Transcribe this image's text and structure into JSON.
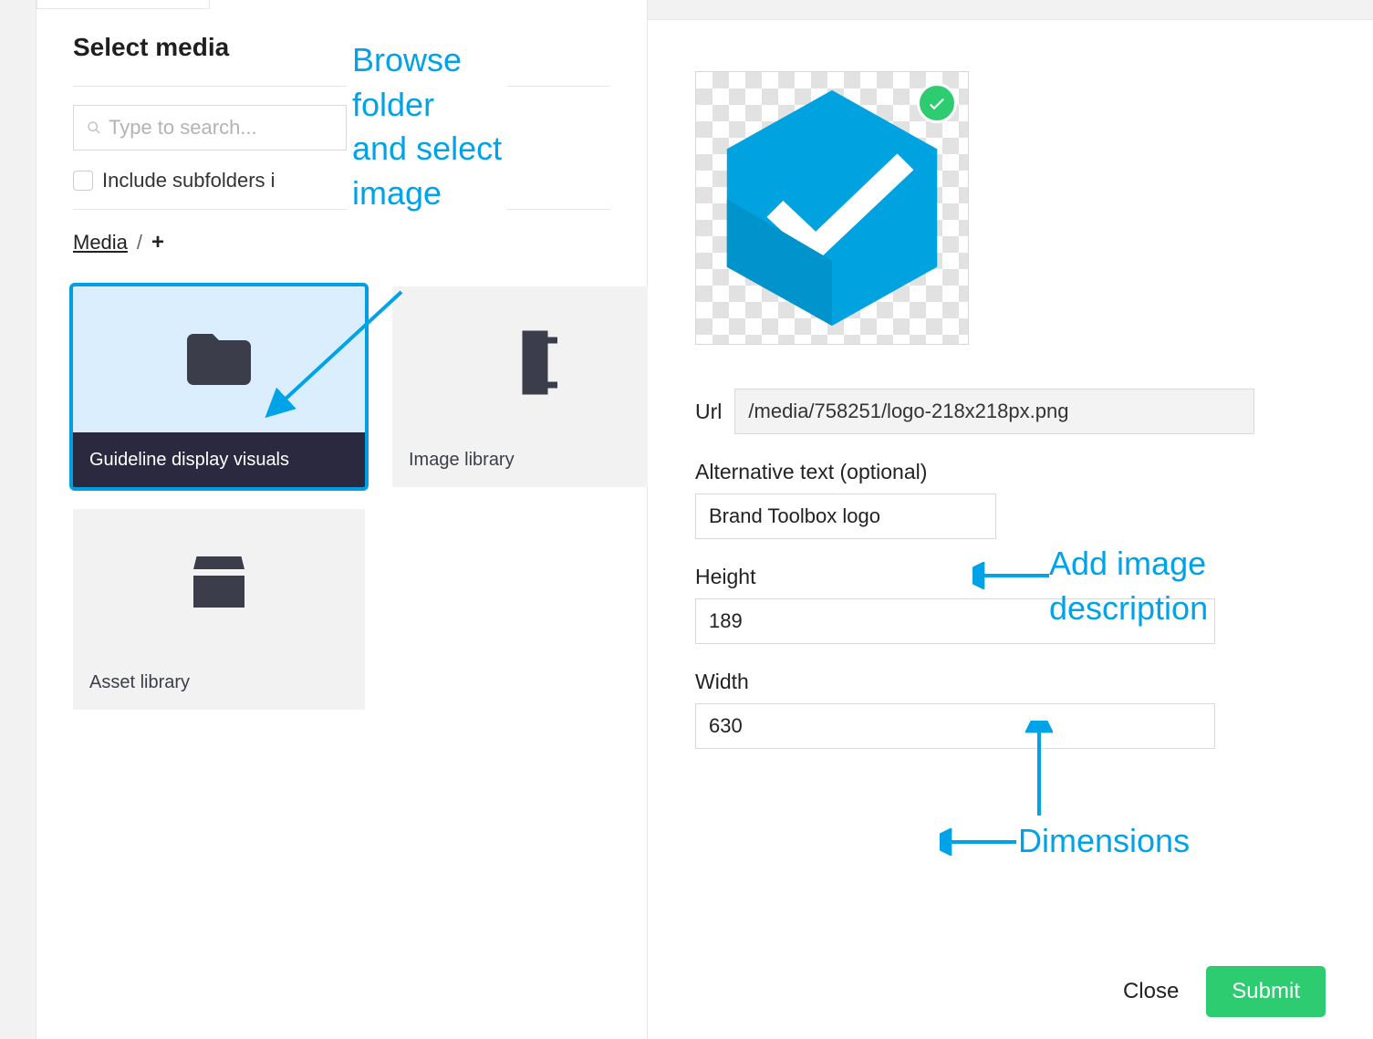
{
  "left": {
    "title": "Select media",
    "search_placeholder": "Type to search...",
    "include_subfolders_label": "Include subfolders i",
    "breadcrumb": {
      "root": "Media",
      "sep": "/",
      "add": "+"
    },
    "tiles": [
      {
        "label": "Guideline display visuals",
        "icon": "folder",
        "selected": true
      },
      {
        "label": "Image library",
        "icon": "film-roll",
        "selected": false
      },
      {
        "label": "Asset library",
        "icon": "archive",
        "selected": false
      }
    ]
  },
  "right": {
    "url_label": "Url",
    "url_value": "/media/758251/logo-218x218px.png",
    "alt_label": "Alternative text (optional)",
    "alt_value": "Brand Toolbox logo",
    "height_label": "Height",
    "height_value": "189",
    "width_label": "Width",
    "width_value": "630",
    "close_label": "Close",
    "submit_label": "Submit"
  },
  "annotations": {
    "browse": "Browse\nfolder\nand select\nimage",
    "add_desc": "Add image\ndescription",
    "dimensions": "Dimensions"
  },
  "colors": {
    "accent": "#009fe3",
    "annotation": "#00a3e8",
    "submit": "#2ecc71",
    "tile_selected_bg": "#dbeefd",
    "tile_label_selected_bg": "#2b2940"
  }
}
